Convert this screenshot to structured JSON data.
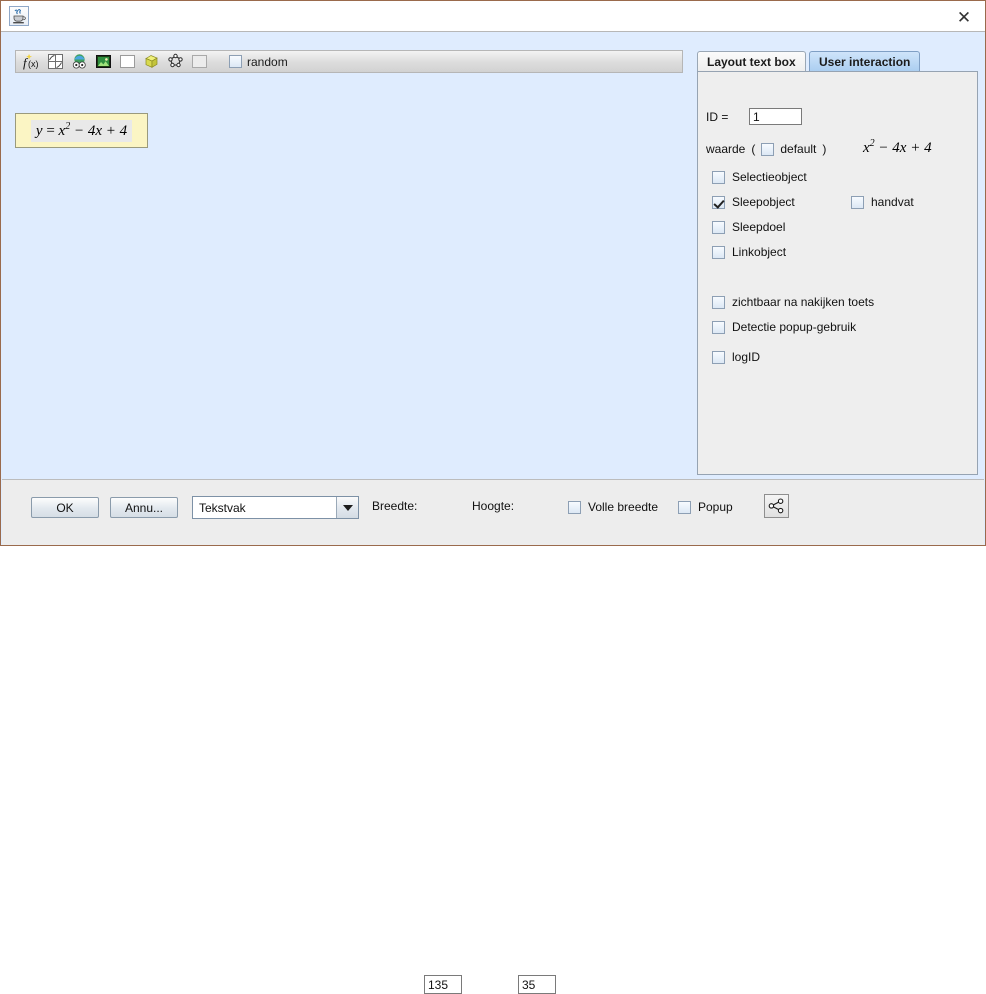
{
  "window": {
    "app_icon": "java-coffee-cup-icon",
    "close_label": "✕"
  },
  "toolbar": {
    "items": [
      {
        "name": "function-tool",
        "glyph": "f(x)"
      },
      {
        "name": "grid-tool",
        "glyph": "grid"
      },
      {
        "name": "globe-tool",
        "glyph": "globe"
      },
      {
        "name": "picture-tool",
        "glyph": "picture"
      },
      {
        "name": "rectangle-tool",
        "glyph": "square"
      },
      {
        "name": "cube-tool",
        "glyph": "cube"
      },
      {
        "name": "polygon-tool",
        "glyph": "polygon"
      },
      {
        "name": "blank-tool",
        "glyph": "square-dim"
      }
    ],
    "random_label": "random",
    "random_checked": false
  },
  "canvas": {
    "formula": {
      "lhs": "y",
      "eq": "=",
      "base": "x",
      "exponent": "2",
      "rest": "− 4x + 4",
      "full_text": "y = x² − 4x + 4"
    }
  },
  "panel": {
    "tabs": [
      {
        "label": "Layout text box",
        "active": false
      },
      {
        "label": "User interaction",
        "active": true
      }
    ],
    "id_label": "ID =",
    "id_value": "1",
    "waarde_label": "waarde",
    "paren_open": "(",
    "default_label": "default",
    "default_checked": false,
    "paren_close": ")",
    "waarde_math": {
      "base": "x",
      "exponent": "2",
      "rest": "− 4x + 4",
      "full_text": "x² − 4x + 4"
    },
    "checkboxes": [
      {
        "label": "Selectieobject",
        "checked": false
      },
      {
        "label": "Sleepobject",
        "checked": true
      },
      {
        "label": "handvat",
        "checked": false
      },
      {
        "label": "Sleepdoel",
        "checked": false
      },
      {
        "label": "Linkobject",
        "checked": false
      },
      {
        "label": "zichtbaar na nakijken toets",
        "checked": false
      },
      {
        "label": "Detectie popup-gebruik",
        "checked": false
      },
      {
        "label": "logID",
        "checked": false
      }
    ]
  },
  "bottom": {
    "ok_label": "OK",
    "cancel_label": "Annu...",
    "type_selected": "Tekstvak",
    "breedte_label": "Breedte:",
    "breedte_value": "135",
    "hoogte_label": "Hoogte:",
    "hoogte_value": "35",
    "volle_breedte_label": "Volle breedte",
    "volle_breedte_checked": false,
    "popup_label": "Popup",
    "popup_checked": false,
    "share_icon": "share-nodes-icon"
  },
  "colors": {
    "canvas_bg": "#dfecfe",
    "panel_bg": "#eeeeee",
    "active_tab": "#a9cdf0",
    "formula_bg": "#fbf5c4",
    "window_border": "#9a6a4c"
  }
}
